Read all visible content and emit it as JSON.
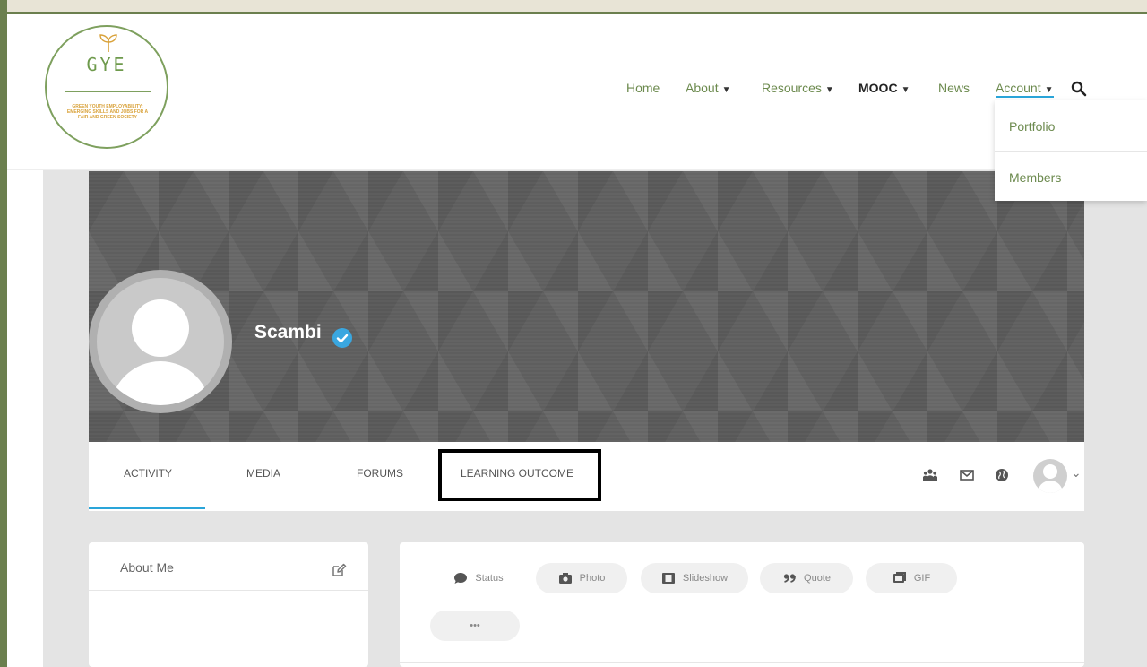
{
  "logo": {
    "wordmark": "GYE",
    "tagline": "GREEN YOUTH EMPLOYABILITY: EMERGING SKILLS AND JOBS FOR A FAIR AND GREEN SOCIETY",
    "icon": "sprout-icon"
  },
  "nav": {
    "items": [
      {
        "label": "Home",
        "dropdown": false
      },
      {
        "label": "About",
        "dropdown": true
      },
      {
        "label": "Resources",
        "dropdown": true
      },
      {
        "label": "MOOC",
        "dropdown": true
      },
      {
        "label": "News",
        "dropdown": false
      },
      {
        "label": "Account",
        "dropdown": true,
        "active": true
      }
    ],
    "search_icon": "search-icon",
    "account_menu": [
      "Portfolio",
      "Members"
    ]
  },
  "profile": {
    "name": "Scambi",
    "verified_icon": "verified-badge-icon"
  },
  "tabs": [
    {
      "label": "ACTIVITY",
      "active": true
    },
    {
      "label": "MEDIA"
    },
    {
      "label": "FORUMS"
    },
    {
      "label": "LEARNING OUTCOME",
      "highlighted": true
    }
  ],
  "tab_icons": [
    "groups-icon",
    "mail-icon",
    "globe-icon",
    "user-avatar-icon",
    "chevron-down-icon"
  ],
  "about": {
    "title": "About Me",
    "edit_icon": "edit-icon"
  },
  "composer": {
    "buttons": [
      {
        "label": "Status",
        "icon": "speech-bubble-icon"
      },
      {
        "label": "Photo",
        "icon": "camera-icon"
      },
      {
        "label": "Slideshow",
        "icon": "film-icon"
      },
      {
        "label": "Quote",
        "icon": "quote-icon"
      },
      {
        "label": "GIF",
        "icon": "gif-icon"
      }
    ],
    "more_label": "•••"
  },
  "colors": {
    "accent": "#2aa5d9",
    "nav_green": "#6c8a4e",
    "frame_green": "#6b7f4e",
    "logo_gold": "#d9a23a"
  }
}
